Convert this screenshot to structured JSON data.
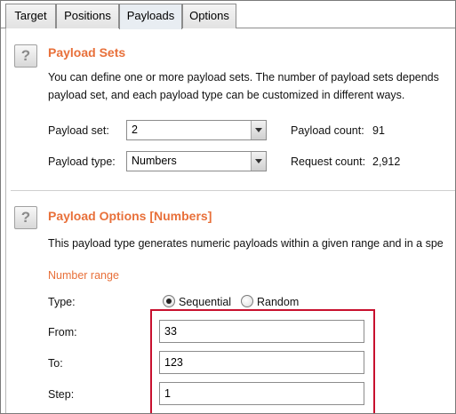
{
  "tabs": [
    {
      "label": "Target"
    },
    {
      "label": "Positions"
    },
    {
      "label": "Payloads"
    },
    {
      "label": "Options"
    }
  ],
  "payload_sets": {
    "help_label": "?",
    "title": "Payload Sets",
    "description_line1": "You can define one or more payload sets. The number of payload sets depends",
    "description_line2": "payload set, and each payload type can be customized in different ways.",
    "payload_set_label": "Payload set:",
    "payload_set_value": "2",
    "payload_type_label": "Payload type:",
    "payload_type_value": "Numbers",
    "payload_count_label": "Payload count:",
    "payload_count_value": "91",
    "request_count_label": "Request count:",
    "request_count_value": "2,912"
  },
  "payload_options": {
    "help_label": "?",
    "title": "Payload Options [Numbers]",
    "description": "This payload type generates numeric payloads within a given range and in a spe",
    "number_range_heading": "Number range",
    "type_label": "Type:",
    "type_options": [
      {
        "label": "Sequential",
        "selected": true
      },
      {
        "label": "Random",
        "selected": false
      }
    ],
    "from_label": "From:",
    "from_value": "33",
    "to_label": "To:",
    "to_value": "123",
    "step_label": "Step:",
    "step_value": "1"
  },
  "colors": {
    "accent": "#e8703a",
    "highlight": "#c8102e"
  }
}
